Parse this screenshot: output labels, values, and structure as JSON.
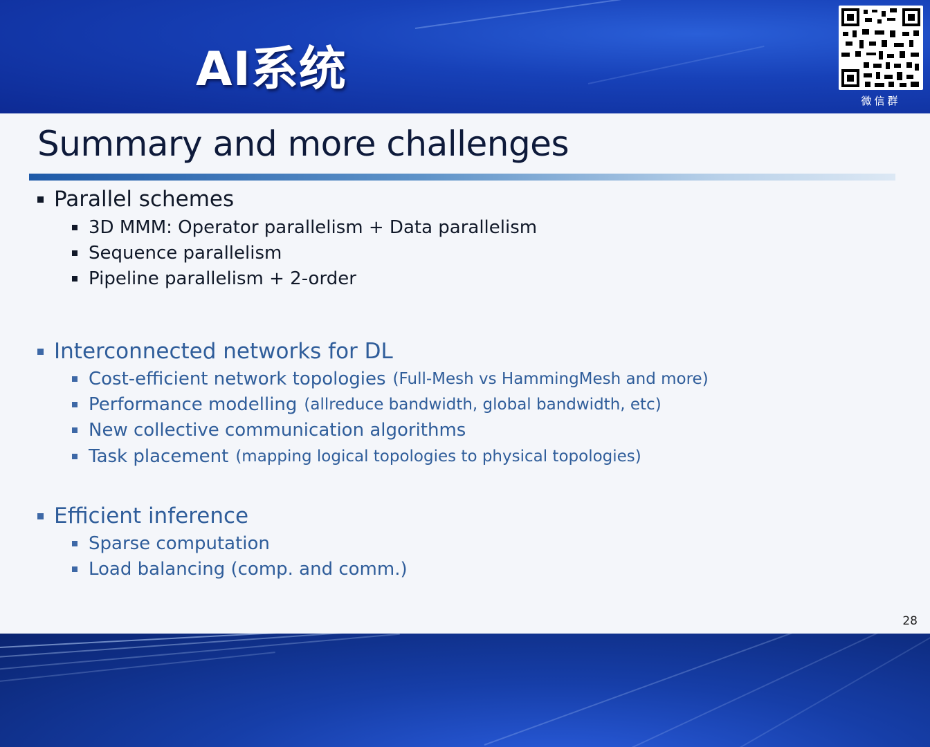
{
  "banner": {
    "title": "AI系统",
    "qr_caption": "微信群"
  },
  "slide": {
    "title": "Summary and more challenges",
    "page_number": "28",
    "sections": [
      {
        "heading": "Parallel schemes",
        "items": [
          {
            "text": "3D MMM: Operator parallelism + Data parallelism",
            "note": ""
          },
          {
            "text": "Sequence parallelism",
            "note": ""
          },
          {
            "text": "Pipeline parallelism + 2-order",
            "note": ""
          }
        ]
      },
      {
        "heading": "Interconnected networks for DL",
        "items": [
          {
            "text": "Cost-efficient network topologies",
            "note": "(Full-Mesh vs HammingMesh and more)"
          },
          {
            "text": "Performance modelling",
            "note": "(allreduce bandwidth, global bandwidth, etc)"
          },
          {
            "text": "New collective communication algorithms",
            "note": ""
          },
          {
            "text": "Task placement",
            "note": "(mapping logical topologies to physical topologies)"
          }
        ]
      },
      {
        "heading": "Efficient inference",
        "items": [
          {
            "text": "Sparse computation",
            "note": ""
          },
          {
            "text": "Load balancing (comp. and comm.)",
            "note": ""
          }
        ]
      }
    ]
  },
  "colors": {
    "banner_blue": "#1741b8",
    "heading_dark": "#101828",
    "heading_blue": "#2f5d9a"
  },
  "icons": [
    "qr-code-icon",
    "bullet-square-icon"
  ]
}
